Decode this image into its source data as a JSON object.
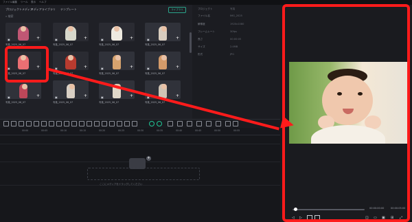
{
  "menu": [
    "ファイル",
    "編集",
    "ツール",
    "表示",
    "ヘルプ"
  ],
  "library": {
    "tabs": [
      "プロジェクトメディア",
      "メディアライブラリ",
      "テンプレート"
    ],
    "button": "ライブラリ",
    "search_placeholder": "検索",
    "tiles": [
      {
        "label": "写真_2025_06_07"
      },
      {
        "label": "写真_2025_06_07"
      },
      {
        "label": "写真_2025_06_07"
      },
      {
        "label": "写真_2025_06_07"
      },
      {
        "label": "写真_2025_06_07"
      },
      {
        "label": "写真_2025_06_07"
      },
      {
        "label": "写真_2025_06_07"
      },
      {
        "label": "写真_2025_06_07"
      },
      {
        "label": "写真_2025_06_07"
      },
      {
        "label": "写真_2025_06_07"
      },
      {
        "label": "写真_2025_06_07"
      },
      {
        "label": "写真_2025_06_07"
      }
    ]
  },
  "properties": {
    "labels": [
      "プロジェクト",
      "ファイル名",
      "解像度",
      "フレームレート",
      "長さ",
      "サイズ",
      "形式"
    ],
    "values": [
      "写真",
      "IMG_2025",
      "1920x1080",
      "30fps",
      "00:00:05",
      "2.4MB",
      "JPG"
    ]
  },
  "timeline": {
    "ticks": [
      "00:00",
      "00:05",
      "00:10",
      "00:15",
      "00:20",
      "00:25",
      "00:30",
      "00:35",
      "00:40",
      "00:45",
      "00:50",
      "00:55"
    ],
    "drop_message": "ここにメディアをドラッグしてください"
  },
  "preview": {
    "current_time": "00:00:00:00",
    "total_time": "00:00:05:00",
    "progress": 0.02
  },
  "annotation": {
    "color": "#ff1b1b"
  }
}
